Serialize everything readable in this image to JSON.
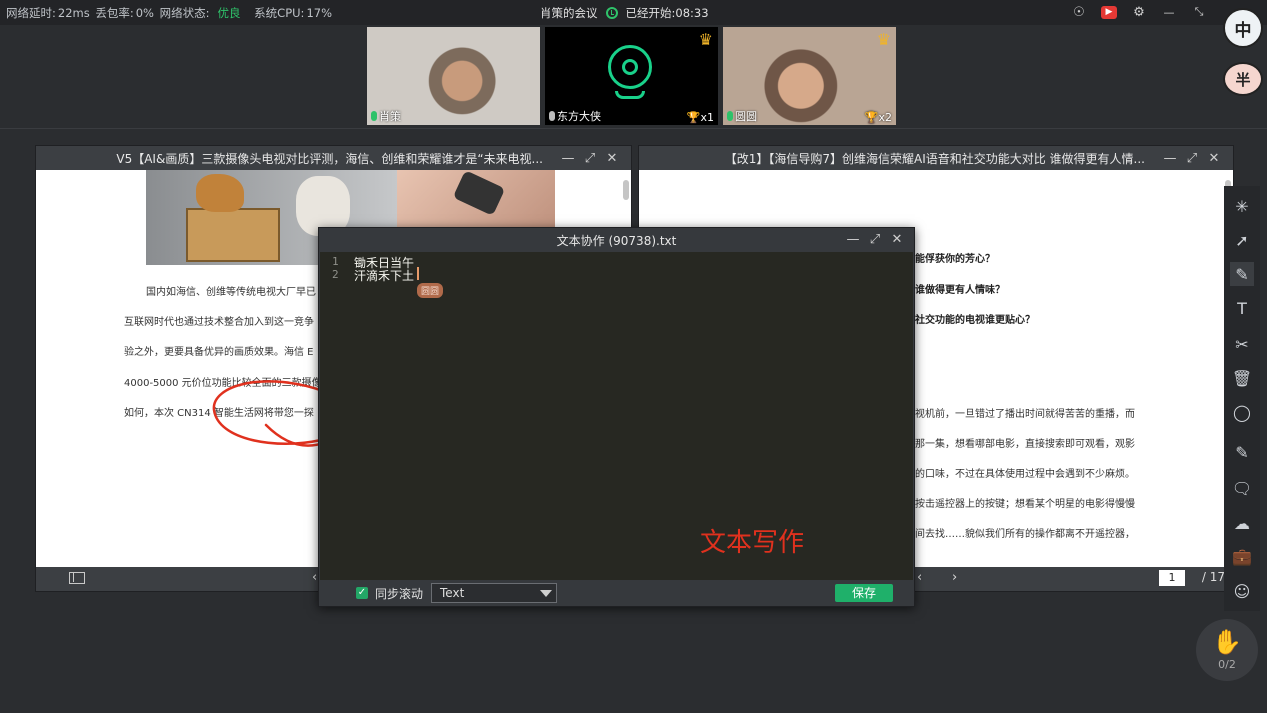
{
  "status": {
    "latency_label": "网络延时:",
    "latency_value": "22ms",
    "loss_label": "丢包率:",
    "loss_value": "0%",
    "net_label": "网络状态:",
    "net_value": "优良",
    "cpu_label": "系统CPU:",
    "cpu_value": "17%"
  },
  "meeting": {
    "name": "肖策的会议",
    "started_label": "已经开始:",
    "elapsed": "08:33"
  },
  "ime": {
    "primary": "中",
    "secondary": "半"
  },
  "participants": [
    {
      "name": "肖策",
      "badge": ""
    },
    {
      "name": "东方大侠",
      "badge": "x1"
    },
    {
      "name": "圆圆",
      "badge": "x2"
    }
  ],
  "doc_left": {
    "title": "V5【AI&画质】三款摄像头电视对比评测，海信、创维和荣耀谁才是“未来电视...",
    "lines": [
      "国内如海信、创维等传统电视大厂早已",
      "互联网时代也通过技术整合加入到这一竞争",
      "验之外，更要具备优异的画质效果。海信 E",
      "4000-5000 元价位功能比较全面的三款摄像",
      "如何，本次 CN314 智能生活网将带您一探"
    ],
    "nav_prev": "‹"
  },
  "doc_right": {
    "title": "【改1】【海信导购7】创维海信荣耀AI语音和社交功能大对比 谁做得更有人情...",
    "questions": [
      "能俘获你的芳心？",
      "谁做得更有人情味？",
      "社交功能的电视谁更贴心？"
    ],
    "lines": [
      "视机前，一旦错过了播出时间就得苦苦的重播，而",
      "那一集，想看哪部电影，直接搜索即可观看，观影",
      "的口味，不过在具体使用过程中会遇到不少麻烦。",
      "按击遥控器上的按键；想看某个明星的电影得慢慢",
      "间去找……貌似我们所有的操作都离不开遥控器，"
    ],
    "nav_prev": "‹",
    "nav_next": "›",
    "page_current": "1",
    "page_total": "/ 17"
  },
  "editor": {
    "title": "文本协作 (90738).txt",
    "line_numbers": [
      "1",
      "2"
    ],
    "lines": [
      "锄禾日当午",
      "汗滴禾下土"
    ],
    "cursor_user": "圆圆",
    "watermark": "文本写作",
    "sync_scroll_label": "同步滚动",
    "sync_scroll_checked": true,
    "language": "Text",
    "save_label": "保存"
  },
  "window_buttons": {
    "minimize": "—",
    "restore": "⤢",
    "close": "✕"
  },
  "raise_hand": {
    "count": "0/2"
  },
  "colors": {
    "accent_green": "#1fb06a",
    "status_good": "#2fc26a",
    "annotation_red": "#e0311e"
  }
}
